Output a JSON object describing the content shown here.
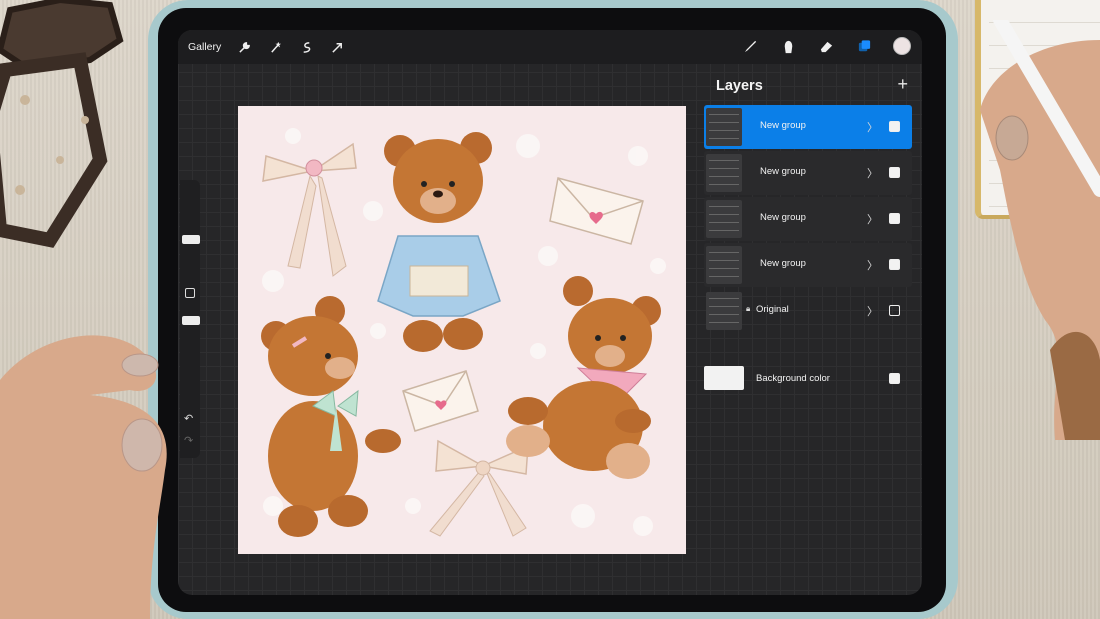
{
  "toolbar": {
    "gallery_label": "Gallery",
    "left_icons": [
      "wrench-icon",
      "magic-wand-icon",
      "selection-icon",
      "transform-arrow-icon"
    ],
    "right_icons": [
      "brush-icon",
      "smudge-icon",
      "eraser-icon",
      "layers-icon"
    ],
    "current_color": "#ede3e3"
  },
  "layers": {
    "title": "Layers",
    "add_label": "+",
    "items": [
      {
        "name": "New group",
        "selected": true,
        "visible": true
      },
      {
        "name": "New group",
        "selected": false,
        "visible": true
      },
      {
        "name": "New group",
        "selected": false,
        "visible": true
      },
      {
        "name": "New group",
        "selected": false,
        "visible": true
      },
      {
        "name": "Original",
        "selected": false,
        "visible": false,
        "locked": true
      }
    ],
    "background": {
      "name": "Background color",
      "color": "#f2f2f2",
      "visible": true
    }
  },
  "colors": {
    "accent": "#0b7fe8",
    "canvas": "#f7e9ea",
    "case": "#a7c9cc"
  }
}
